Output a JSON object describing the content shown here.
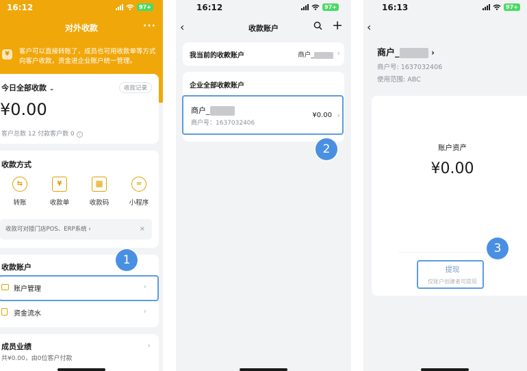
{
  "colors": {
    "brand": "#f0a70a",
    "highlight": "#5b9be0",
    "badge": "#4a90e2"
  },
  "status_bar": {
    "p1": {
      "time": "16:12",
      "battery": "97+"
    },
    "p2": {
      "time": "16:12",
      "battery": "97+"
    },
    "p3": {
      "time": "16:13",
      "battery": "97+"
    }
  },
  "phone1": {
    "title": "对外收款",
    "more": "···",
    "notice": "客户可以直接转账了，成员也可用收款单等方式向客户收款，资金进企业账户统一管理。",
    "today": {
      "title": "今日全部收款",
      "records_button": "收款记录",
      "amount": "¥0.00",
      "stats": "客户总数 12   付款客户数 0"
    },
    "methods": {
      "title": "收款方式",
      "items": [
        {
          "label": "转账",
          "icon": "transfer-icon"
        },
        {
          "label": "收款单",
          "icon": "receipt-icon"
        },
        {
          "label": "收款码",
          "icon": "qrcode-icon"
        },
        {
          "label": "小程序",
          "icon": "miniprogram-icon"
        }
      ],
      "tip": "收款可对接门店POS、ERP系统 ›",
      "tip_close": "×"
    },
    "accounts": {
      "title": "收款账户",
      "items": [
        {
          "label": "账户管理"
        },
        {
          "label": "资金流水"
        }
      ]
    },
    "performance": {
      "title": "成员业绩",
      "summary": "共¥0.00，由0位客户付款"
    },
    "badge": "1"
  },
  "phone2": {
    "title": "收款账户",
    "current": {
      "label": "我当前的收款账户",
      "value": "商户_"
    },
    "all": {
      "title": "企业全部收款账户",
      "merchant_name": "商户_",
      "merchant_no": "商户号：1637032406",
      "amount": "¥0.00"
    },
    "badge": "2"
  },
  "phone3": {
    "merchant_name": "商户_",
    "merchant_no": "商户号: 1637032406",
    "scope": "使用范围: ABC",
    "assets_title": "账户资产",
    "assets_amount": "¥0.00",
    "withdraw_label": "提现",
    "withdraw_note": "仅账户创建者可提现",
    "badge": "3"
  }
}
